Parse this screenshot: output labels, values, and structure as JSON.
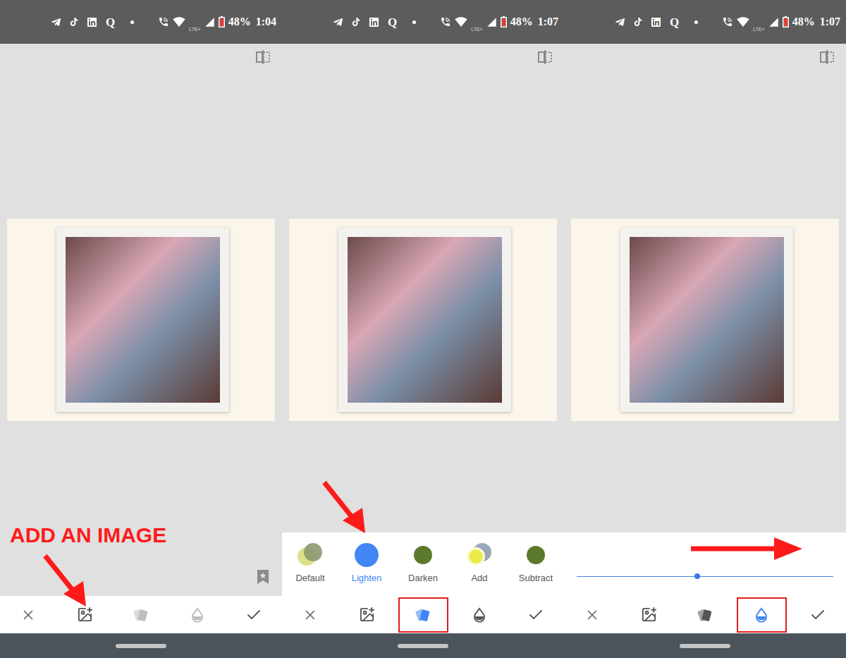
{
  "screens": [
    {
      "status_bar": {
        "quora": "Q",
        "network": "LTE+",
        "battery": "48%",
        "time": "1:04"
      },
      "tools": [
        {
          "kind": "cancel",
          "selected": false,
          "disabled": false,
          "highlighted": false
        },
        {
          "kind": "add-image",
          "selected": false,
          "disabled": false,
          "highlighted": false
        },
        {
          "kind": "blend",
          "selected": false,
          "disabled": true,
          "highlighted": false
        },
        {
          "kind": "opacity",
          "selected": false,
          "disabled": true,
          "highlighted": false
        },
        {
          "kind": "apply",
          "selected": false,
          "disabled": false,
          "highlighted": false
        }
      ],
      "bookmark_shown": true,
      "blend_modes": [],
      "opacity_slider": null,
      "annotation": {
        "kind": "arrow-to-tool",
        "label": "ADD AN IMAGE"
      }
    },
    {
      "status_bar": {
        "quora": "Q",
        "network": "LTE+",
        "battery": "48%",
        "time": "1:07"
      },
      "tools": [
        {
          "kind": "cancel",
          "selected": false,
          "disabled": false,
          "highlighted": false
        },
        {
          "kind": "add-image",
          "selected": false,
          "disabled": false,
          "highlighted": false
        },
        {
          "kind": "blend",
          "selected": true,
          "disabled": false,
          "highlighted": true
        },
        {
          "kind": "opacity",
          "selected": false,
          "disabled": false,
          "highlighted": false
        },
        {
          "kind": "apply",
          "selected": false,
          "disabled": false,
          "highlighted": false
        }
      ],
      "bookmark_shown": false,
      "blend_modes": [
        {
          "label": "Default",
          "kind": "overlap",
          "selected": false
        },
        {
          "label": "Lighten",
          "kind": "single",
          "selected": true
        },
        {
          "label": "Darken",
          "kind": "single",
          "selected": false
        },
        {
          "label": "Add",
          "kind": "bright-overlap",
          "selected": false
        },
        {
          "label": "Subtract",
          "kind": "single",
          "selected": false
        }
      ],
      "opacity_slider": null,
      "annotation": {
        "kind": "arrow-to-mode"
      }
    },
    {
      "status_bar": {
        "quora": "Q",
        "network": "LTE+",
        "battery": "48%",
        "time": "1:07"
      },
      "tools": [
        {
          "kind": "cancel",
          "selected": false,
          "disabled": false,
          "highlighted": false
        },
        {
          "kind": "add-image",
          "selected": false,
          "disabled": false,
          "highlighted": false
        },
        {
          "kind": "blend",
          "selected": false,
          "disabled": false,
          "highlighted": false
        },
        {
          "kind": "opacity",
          "selected": true,
          "disabled": false,
          "highlighted": true
        },
        {
          "kind": "apply",
          "selected": false,
          "disabled": false,
          "highlighted": false
        }
      ],
      "bookmark_shown": false,
      "blend_modes": [],
      "opacity_slider": {
        "level": 0.47
      },
      "annotation": {
        "kind": "arrow-right"
      }
    }
  ]
}
